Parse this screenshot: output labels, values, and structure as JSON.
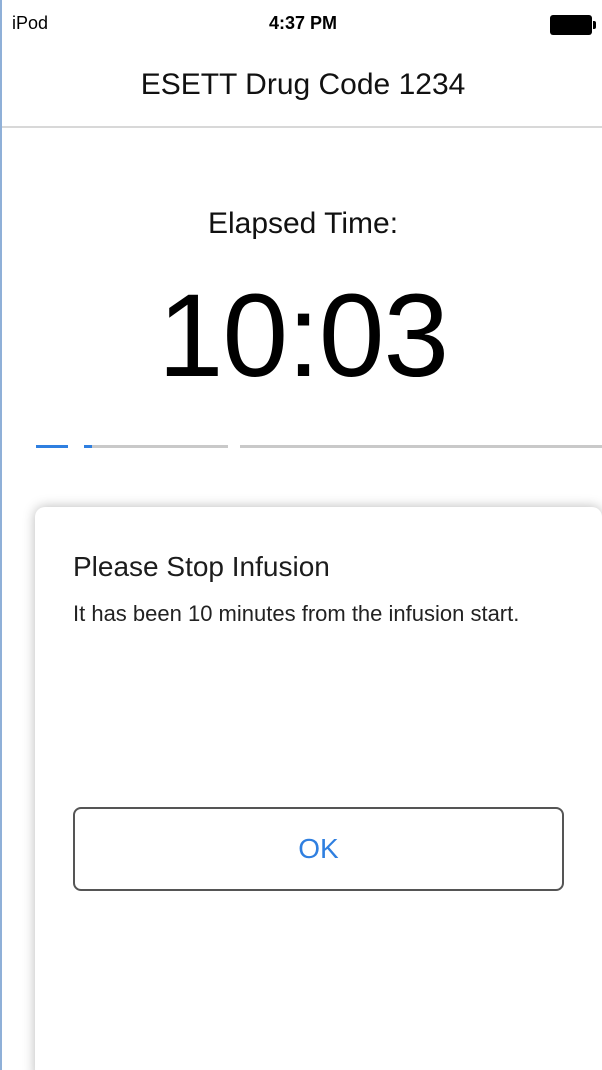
{
  "status_bar": {
    "carrier": "iPod",
    "time": "4:37 PM",
    "battery_icon": "battery-full-icon"
  },
  "nav": {
    "title": "ESETT Drug Code 1234"
  },
  "timer": {
    "label": "Elapsed Time:",
    "value": "10:03"
  },
  "progress": {
    "accent_color": "#2f7fe0",
    "track_color": "#c9c9c9"
  },
  "dialog": {
    "title": "Please Stop Infusion",
    "message": "It has been 10 minutes from the infusion start.",
    "ok_label": "OK",
    "button_color": "#2f7fe0"
  }
}
